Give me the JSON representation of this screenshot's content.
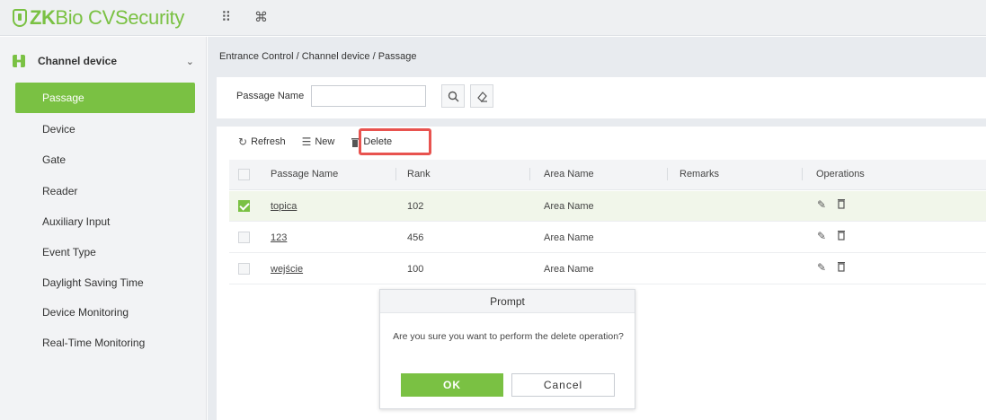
{
  "app": {
    "logo_zk": "ZK",
    "logo_rest": "Bio CVSecurity",
    "logo_icon": "shield-icon"
  },
  "topbar": {
    "icons": [
      "grid-menu-icon",
      "command-icon"
    ],
    "grid_glyph": "⠿",
    "cmd_glyph": "⌘"
  },
  "sidebar": {
    "module": {
      "label": "Channel device",
      "icon": "channel-device-icon",
      "chevron": "⌄"
    },
    "items": [
      {
        "label": "Passage",
        "active": true
      },
      {
        "label": "Device"
      },
      {
        "label": "Gate"
      },
      {
        "label": "Reader"
      },
      {
        "label": "Auxiliary Input"
      },
      {
        "label": "Event Type"
      },
      {
        "label": "Daylight Saving Time"
      },
      {
        "label": "Device Monitoring"
      },
      {
        "label": "Real-Time Monitoring"
      }
    ]
  },
  "breadcrumb": "Entrance Control / Channel device / Passage",
  "search": {
    "label": "Passage Name",
    "value": "",
    "search_icon": "search-icon",
    "clear_icon": "eraser-icon"
  },
  "toolbar": {
    "refresh": "Refresh",
    "new": "New",
    "delete": "Delete",
    "icons": {
      "refresh": "refresh-icon",
      "new": "add-icon",
      "delete": "trash-icon"
    }
  },
  "table": {
    "columns": [
      "Passage Name",
      "Rank",
      "Area Name",
      "Remarks",
      "Operations"
    ],
    "rows": [
      {
        "name": "topica",
        "rank": "102",
        "area": "Area Name",
        "remarks": "",
        "checked": true
      },
      {
        "name": "123",
        "rank": "456",
        "area": "Area Name",
        "remarks": "",
        "checked": false
      },
      {
        "name": "wejście",
        "rank": "100",
        "area": "Area Name",
        "remarks": "",
        "checked": false
      }
    ],
    "op_icons": [
      "edit-icon",
      "trash-icon"
    ]
  },
  "modal": {
    "title": "Prompt",
    "message": "Are you sure you want to perform the delete operation?",
    "ok": "OK",
    "cancel": "Cancel"
  },
  "colors": {
    "accent": "#7ac143",
    "highlight": "#e8534f"
  }
}
